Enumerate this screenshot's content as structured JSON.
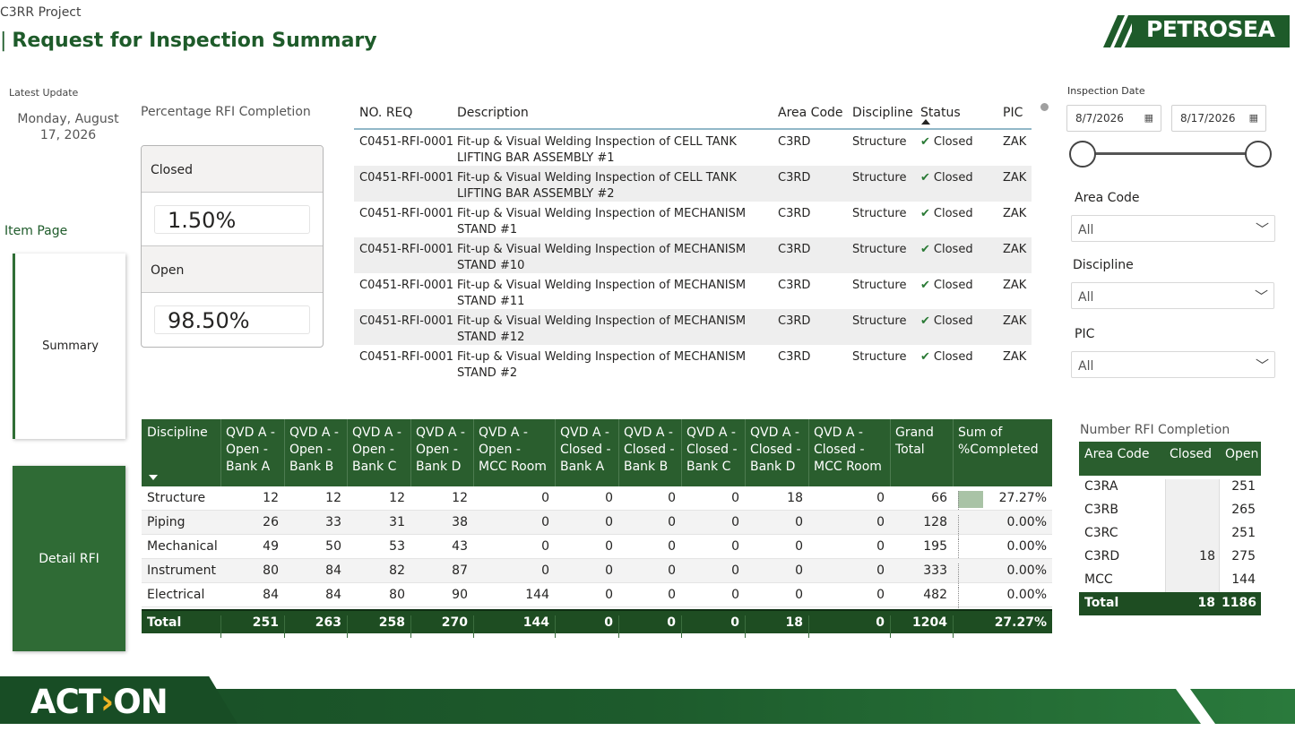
{
  "header": {
    "project": "C3RR Project",
    "title_bar": "|",
    "title": "Request for Inspection Summary",
    "logo_text": "PETROSEA"
  },
  "latest_update": {
    "label": "Latest Update",
    "date": "Monday, August 17, 2026"
  },
  "nav": {
    "item_page_label": "Item Page",
    "summary": "Summary",
    "detail": "Detail RFI"
  },
  "percentage": {
    "title": "Percentage RFI Completion",
    "closed_label": "Closed",
    "closed_value": "1.50%",
    "open_label": "Open",
    "open_value": "98.50%"
  },
  "rfi_table": {
    "headers": {
      "no": "NO. REQ",
      "desc": "Description",
      "area": "Area Code",
      "disc": "Discipline",
      "status": "Status",
      "pic": "PIC"
    },
    "rows": [
      {
        "no": "C0451-RFI-0001",
        "desc": "Fit-up & Visual Welding Inspection of CELL TANK LIFTING BAR ASSEMBLY #1",
        "area": "C3RD",
        "disc": "Structure",
        "status": "Closed",
        "pic": "ZAK"
      },
      {
        "no": "C0451-RFI-0001",
        "desc": "Fit-up & Visual Welding Inspection of CELL TANK LIFTING BAR ASSEMBLY #2",
        "area": "C3RD",
        "disc": "Structure",
        "status": "Closed",
        "pic": "ZAK"
      },
      {
        "no": "C0451-RFI-0001",
        "desc": "Fit-up & Visual Welding Inspection of MECHANISM STAND #1",
        "area": "C3RD",
        "disc": "Structure",
        "status": "Closed",
        "pic": "ZAK"
      },
      {
        "no": "C0451-RFI-0001",
        "desc": "Fit-up & Visual Welding Inspection of MECHANISM STAND #10",
        "area": "C3RD",
        "disc": "Structure",
        "status": "Closed",
        "pic": "ZAK"
      },
      {
        "no": "C0451-RFI-0001",
        "desc": "Fit-up & Visual Welding Inspection of MECHANISM STAND #11",
        "area": "C3RD",
        "disc": "Structure",
        "status": "Closed",
        "pic": "ZAK"
      },
      {
        "no": "C0451-RFI-0001",
        "desc": "Fit-up & Visual Welding Inspection of MECHANISM STAND #12",
        "area": "C3RD",
        "disc": "Structure",
        "status": "Closed",
        "pic": "ZAK"
      },
      {
        "no": "C0451-RFI-0001",
        "desc": "Fit-up & Visual Welding Inspection of MECHANISM STAND #2",
        "area": "C3RD",
        "disc": "Structure",
        "status": "Closed",
        "pic": "ZAK"
      }
    ]
  },
  "filters": {
    "inspection_date_label": "Inspection Date",
    "date_from": "8/7/2026",
    "date_to": "8/17/2026",
    "area_code_label": "Area Code",
    "area_code_value": "All",
    "discipline_label": "Discipline",
    "discipline_value": "All",
    "pic_label": "PIC",
    "pic_value": "All"
  },
  "matrix": {
    "headers": [
      [
        "Discipline"
      ],
      [
        "QVD A -",
        "Open -",
        "Bank A"
      ],
      [
        "QVD A -",
        "Open -",
        "Bank B"
      ],
      [
        "QVD A -",
        "Open -",
        "Bank C"
      ],
      [
        "QVD A -",
        "Open -",
        "Bank D"
      ],
      [
        "QVD A -",
        "Open -",
        "MCC Room"
      ],
      [
        "QVD A -",
        "Closed -",
        "Bank A"
      ],
      [
        "QVD A -",
        "Closed -",
        "Bank B"
      ],
      [
        "QVD A -",
        "Closed -",
        "Bank C"
      ],
      [
        "QVD A -",
        "Closed -",
        "Bank D"
      ],
      [
        "QVD A -",
        "Closed -",
        "MCC Room"
      ],
      [
        "Grand",
        "Total"
      ],
      [
        "Sum of",
        "%Completed"
      ]
    ],
    "rows": [
      {
        "name": "Structure",
        "cells": [
          "12",
          "12",
          "12",
          "12",
          "0",
          "0",
          "0",
          "0",
          "18",
          "0",
          "66"
        ],
        "pct": "27.27%",
        "pct_value": 27.27
      },
      {
        "name": "Piping",
        "cells": [
          "26",
          "33",
          "31",
          "38",
          "0",
          "0",
          "0",
          "0",
          "0",
          "0",
          "128"
        ],
        "pct": "0.00%",
        "pct_value": 0
      },
      {
        "name": "Mechanical",
        "cells": [
          "49",
          "50",
          "53",
          "43",
          "0",
          "0",
          "0",
          "0",
          "0",
          "0",
          "195"
        ],
        "pct": "0.00%",
        "pct_value": 0
      },
      {
        "name": "Instrument",
        "cells": [
          "80",
          "84",
          "82",
          "87",
          "0",
          "0",
          "0",
          "0",
          "0",
          "0",
          "333"
        ],
        "pct": "0.00%",
        "pct_value": 0
      },
      {
        "name": "Electrical",
        "cells": [
          "84",
          "84",
          "80",
          "90",
          "144",
          "0",
          "0",
          "0",
          "0",
          "0",
          "482"
        ],
        "pct": "0.00%",
        "pct_value": 0
      }
    ],
    "total": {
      "name": "Total",
      "cells": [
        "251",
        "263",
        "258",
        "270",
        "144",
        "0",
        "0",
        "0",
        "18",
        "0",
        "1204"
      ],
      "pct": "27.27%"
    }
  },
  "number_completion": {
    "title": "Number RFI Completion",
    "headers": [
      "Area Code",
      "Closed",
      "Open"
    ],
    "rows": [
      {
        "area": "C3RA",
        "closed": "",
        "open": "251"
      },
      {
        "area": "C3RB",
        "closed": "",
        "open": "265"
      },
      {
        "area": "C3RC",
        "closed": "",
        "open": "251"
      },
      {
        "area": "C3RD",
        "closed": "18",
        "open": "275"
      },
      {
        "area": "MCC",
        "closed": "",
        "open": "144"
      }
    ],
    "total": {
      "area": "Total",
      "closed": "18",
      "open": "1186"
    }
  },
  "footer": {
    "logo_pre": "ACT",
    "logo_mid": "›",
    "logo_post": "ON"
  },
  "colors": {
    "brand_green": "#1e5b2a",
    "header_green": "#2a5e2e",
    "total_green": "#1e4d22",
    "databar": "#a9c3a6",
    "check_green": "#2a7a35"
  }
}
